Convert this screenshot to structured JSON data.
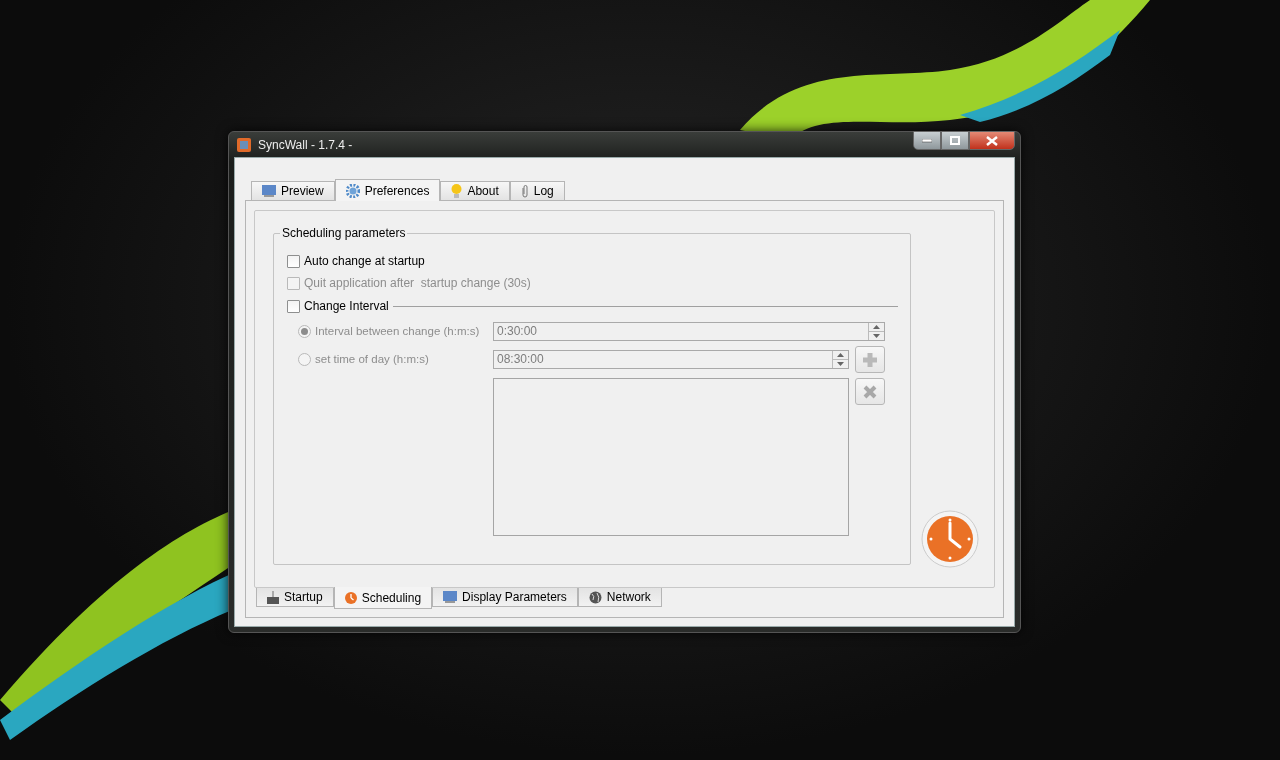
{
  "window": {
    "title": "SyncWall - 1.7.4 -"
  },
  "tabs": [
    {
      "label": "Preview",
      "selected": false
    },
    {
      "label": "Preferences",
      "selected": true
    },
    {
      "label": "About",
      "selected": false
    },
    {
      "label": "Log",
      "selected": false
    }
  ],
  "group": {
    "title": "Scheduling parameters"
  },
  "options": [
    {
      "label": "Auto change at startup",
      "checked": false,
      "disabled": false
    },
    {
      "label": "Quit application after  startup change (30s)",
      "checked": false,
      "disabled": true
    }
  ],
  "change_interval": {
    "label": "Change Interval",
    "checked": false
  },
  "interval_modes": [
    {
      "label": "Interval between change (h:m:s)",
      "selected": true,
      "disabled": true,
      "value": "0:30:00"
    },
    {
      "label": "set time of day (h:m:s)",
      "selected": false,
      "disabled": true,
      "value": "08:30:00"
    }
  ],
  "bottom_tabs": [
    {
      "label": "Startup",
      "selected": false
    },
    {
      "label": "Scheduling",
      "selected": true
    },
    {
      "label": "Display Parameters",
      "selected": false
    },
    {
      "label": "Network",
      "selected": false
    }
  ]
}
